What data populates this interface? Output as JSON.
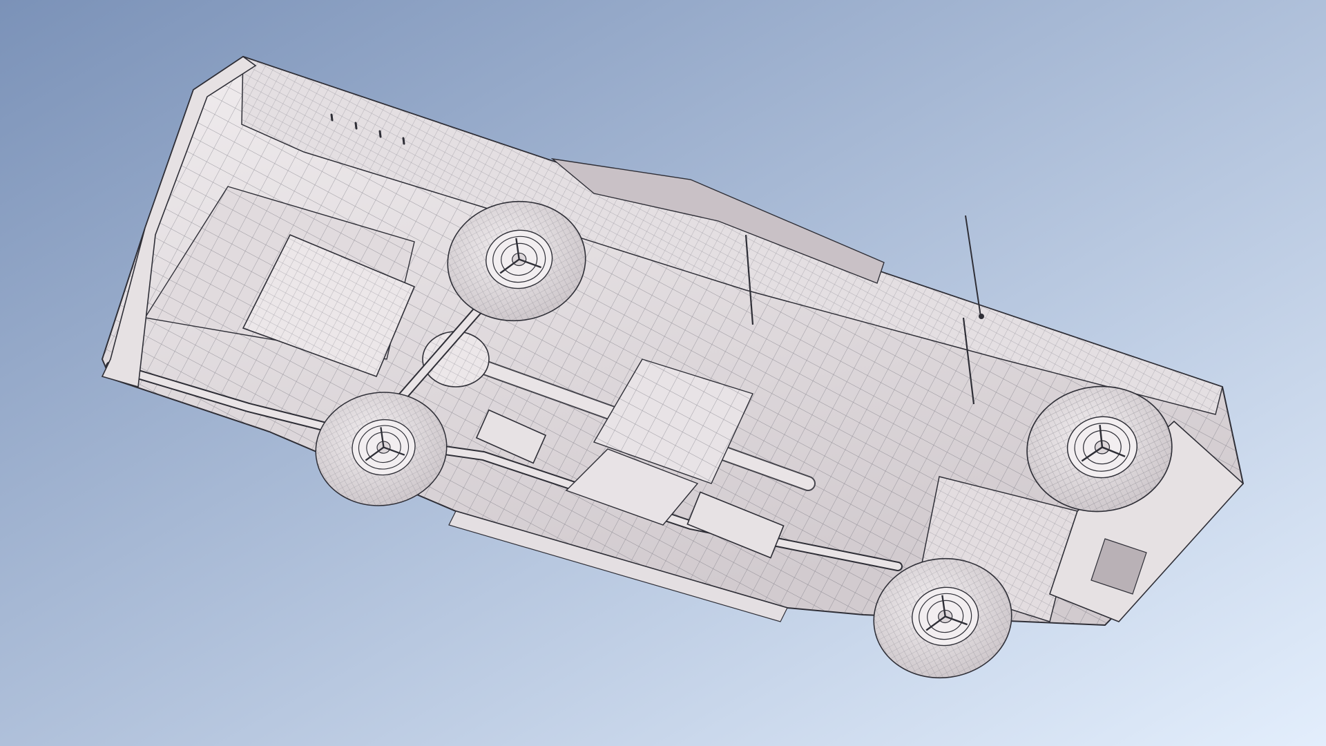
{
  "scene": {
    "subject": "car-underside-wireframe-model",
    "colors": {
      "background_top_left": "#7b92b8",
      "background_bottom_right": "#e3eefc",
      "model_fill": "#e9e4e6",
      "model_shade": "#cfc8cc",
      "model_dark": "#b9b1b6",
      "wire_line": "#5a5a66",
      "edge_line": "#2e2e36",
      "glass": "#c9c1c6",
      "tire": "#ddd7da",
      "hub": "#f2eef0"
    },
    "icons": {
      "antenna": "antenna-icon",
      "wheels": "wheel-icon"
    }
  }
}
